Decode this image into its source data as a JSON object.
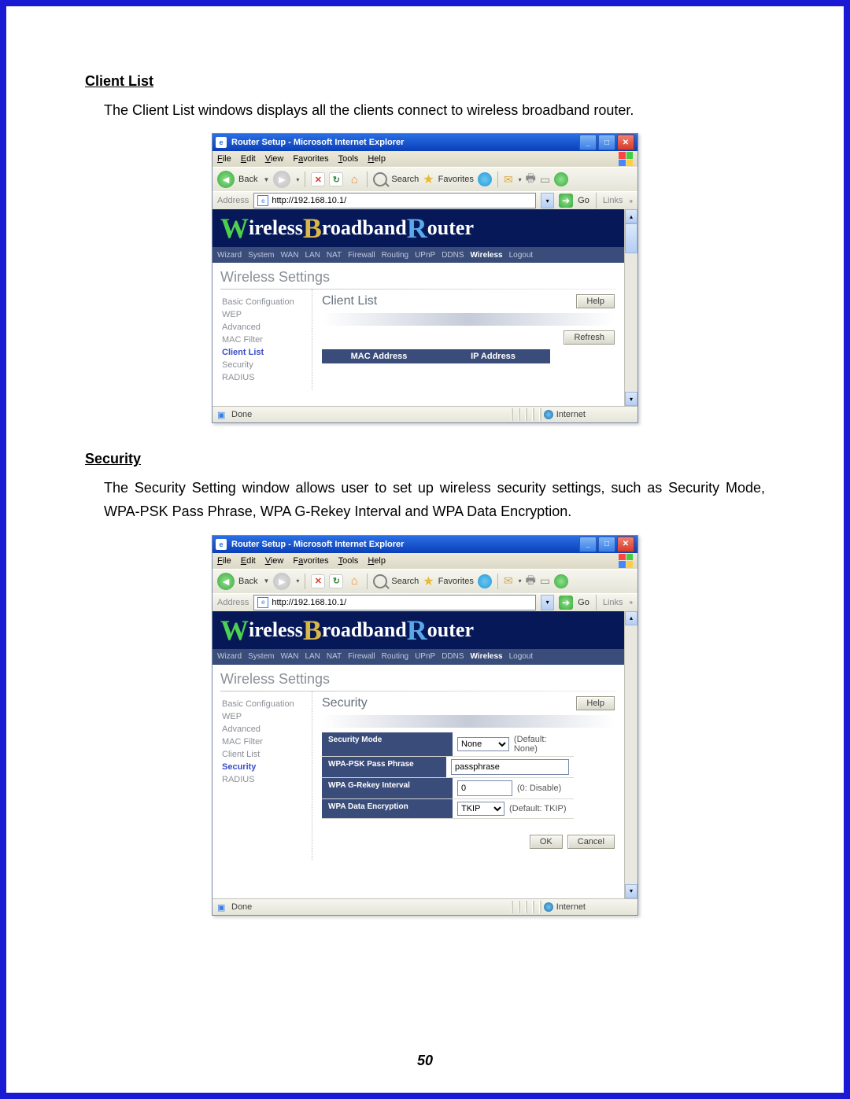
{
  "doc": {
    "heading1": "Client List",
    "para1": "The Client List windows displays all the clients connect to wireless broadband router.",
    "heading2": "Security",
    "para2": "The Security Setting window allows user to set up wireless security settings, such as Security Mode, WPA-PSK Pass Phrase, WPA G-Rekey Interval and WPA Data Encryption.",
    "page": "50"
  },
  "ie": {
    "title": "Router Setup - Microsoft Internet Explorer",
    "menu": [
      "File",
      "Edit",
      "View",
      "Favorites",
      "Tools",
      "Help"
    ],
    "tool": {
      "back": "Back",
      "search": "Search",
      "favorites": "Favorites"
    },
    "addr_label": "Address",
    "addr_value": "http://192.168.10.1/",
    "go": "Go",
    "links": "Links",
    "status_left": "Done",
    "status_right": "Internet"
  },
  "router": {
    "banner": {
      "w": "W",
      "w_rest": "ireless ",
      "b": "B",
      "b_rest": "roadband ",
      "r": "R",
      "r_rest": "outer"
    },
    "nav": [
      "Wizard",
      "System",
      "WAN",
      "LAN",
      "NAT",
      "Firewall",
      "Routing",
      "UPnP",
      "DDNS",
      "Wireless",
      "Logout"
    ],
    "nav_active": "Wireless",
    "page_title": "Wireless Settings",
    "side": [
      "Basic Configuation",
      "WEP",
      "Advanced",
      "MAC Filter",
      "Client List",
      "Security",
      "RADIUS"
    ]
  },
  "clientlist": {
    "side_active": "Client List",
    "panel_title": "Client List",
    "help": "Help",
    "refresh": "Refresh",
    "cols": [
      "MAC Address",
      "IP Address"
    ]
  },
  "security": {
    "side_active": "Security",
    "panel_title": "Security",
    "help": "Help",
    "ok": "OK",
    "cancel": "Cancel",
    "rows": [
      {
        "label": "Security Mode",
        "value": "None",
        "hint": "(Default: None)",
        "type": "select"
      },
      {
        "label": "WPA-PSK Pass Phrase",
        "value": "passphrase",
        "hint": "",
        "type": "text"
      },
      {
        "label": "WPA G-Rekey Interval",
        "value": "0",
        "hint": "(0: Disable)",
        "type": "text"
      },
      {
        "label": "WPA Data Encryption",
        "value": "TKIP",
        "hint": "(Default: TKIP)",
        "type": "select"
      }
    ]
  }
}
